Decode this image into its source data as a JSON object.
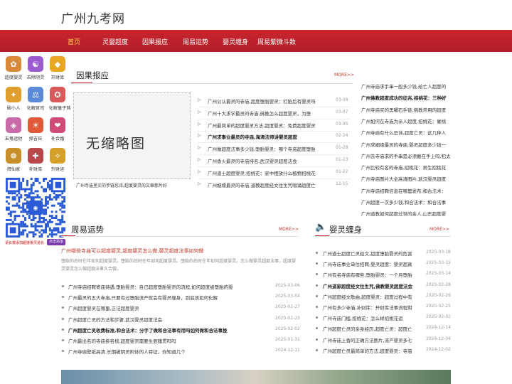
{
  "site": {
    "title": "广州九考网"
  },
  "nav": [
    "首页",
    "灵婴超度",
    "因果报应",
    "周易运势",
    "婴灵缠身",
    "周易紫微斗数"
  ],
  "apps": [
    {
      "label": "超度婴灵",
      "color": "#d9893a",
      "glyph": "✿"
    },
    {
      "label": "去除阴灵",
      "color": "#9a5ad0",
      "glyph": "☯"
    },
    {
      "label": "开财库",
      "color": "#e8a623",
      "glyph": "◆"
    },
    {
      "label": "破小人",
      "color": "#e0a030",
      "glyph": "✦"
    },
    {
      "label": "化解官司",
      "color": "#5a8ad8",
      "glyph": "⚖"
    },
    {
      "label": "化解童子煞",
      "color": "#d85a5a",
      "glyph": "✪"
    },
    {
      "label": "五鬼运财",
      "color": "#c86aa8",
      "glyph": "◈"
    },
    {
      "label": "择吉日",
      "color": "#e05a3a",
      "glyph": "☀"
    },
    {
      "label": "补合婚",
      "color": "#d04a7a",
      "glyph": "❤"
    },
    {
      "label": "拜仙家",
      "color": "#c8902a",
      "glyph": "☸"
    },
    {
      "label": "补财库",
      "color": "#b8484a",
      "glyph": "✚"
    },
    {
      "label": "升财运",
      "color": "#d4a02a",
      "glyph": "✧"
    }
  ],
  "qr": {
    "caption": "请长按添加超度婴灵道长",
    "button": "点击添加"
  },
  "karma": {
    "title": "因果报应",
    "more": "MORE>>",
    "thumb_text": "无缩略图",
    "thumb_caption": "广州寺庙里买的手链忌讳,超度婴灵的文章那片好",
    "items": [
      {
        "text": "广州公认最灵的寺庙,超度堕胎婴灵：打胎后有婴灵吗",
        "date": "03-08",
        "bold": false
      },
      {
        "text": "广州十大求学最灵的寺庙,佛教怎么超度婴灵，为堕",
        "date": "03-07",
        "bold": false
      },
      {
        "text": "广州最简单的超度婴灵方法,超度婴灵：免费超度婴灵",
        "date": "03-05",
        "bold": false
      },
      {
        "text": "广州求事业最灵的寺庙,海清法师讲婴灵超度",
        "date": "02-24",
        "bold": true
      },
      {
        "text": "广州做超度法事多少钱,堕胎婴灵：哪个寺庙超度堕胎",
        "date": "01-28",
        "bold": false
      },
      {
        "text": "广州香火最灵的寺庙排名,武汉婴灵超度法会",
        "date": "01-23",
        "bold": false
      },
      {
        "text": "广州道士超度婴灵,招桃花：家中摆放什么植物招桃花",
        "date": "01-22",
        "bold": false
      },
      {
        "text": "广州姻缘最灵的寺庙,道教超度经文往生咒唱诵超度亡",
        "date": "12-15",
        "bold": false
      }
    ],
    "side": [
      {
        "text": "广州寺庙求手串一般多少钱,给亡人超度的",
        "bold": false
      },
      {
        "text": "广州佛教超度成功的征兆,招桃花：三种好",
        "bold": true
      },
      {
        "text": "广州寺庙买的黑曜石手链,佛教常用的超度",
        "bold": false
      },
      {
        "text": "广州如何在寺庙为亲人超度,招桃花：催桃",
        "bold": false
      },
      {
        "text": "广州寺庙有什么忌讳,超度亡灵：这几种人",
        "bold": false
      },
      {
        "text": "广州求姻缘最灵的寺庙,婴灵超度多少钱一",
        "bold": false
      },
      {
        "text": "广州去寺庙求的手串是必须戴在手上吗,犯太",
        "bold": false
      },
      {
        "text": "广州比较有名的寺庙,招桃花：男生招桃花",
        "bold": false
      },
      {
        "text": "广州寺庙图片大全高清图片,武汉婴灵超度",
        "bold": false
      },
      {
        "text": "广州寺庙招聘信息在哪里发布,和合法术：",
        "bold": false
      },
      {
        "text": "广州超度一次多少钱,和合法术：和合法事",
        "bold": false
      },
      {
        "text": "广州道教如何超度过世的亲人,山东超度婴",
        "bold": false
      }
    ]
  },
  "fortune": {
    "title": "周易运势",
    "more": "MORE>>",
    "headline": "广州哪些寺庙可以超度婴灵,超度婴灵怎么做,婴灵超度法事如何做",
    "summary": "堕胎的后时在年如何超度婴灵。堕胎的后时在年如何超度婴灵。堕胎的后时在年如何超度婴灵。怎么做婴灵超度法事，超度婴灵婴灵怎么做超度法事久合做。",
    "items": [
      {
        "text": "广州寺庙招聘寄庙待遇,堕胎婴灵：自己超度堕胎婴灵的流程,如何超度被堕胎的婴",
        "date": "2025-03-06",
        "bold": false
      },
      {
        "text": "广州最灵的五大寺庙,只要有过堕胎流产就会有婴灵缠身，到底该如何化解",
        "date": "2025-03-04",
        "bold": false
      },
      {
        "text": "广州超度婴灵在哪里,正法超度婴灵",
        "date": "2025-02-27",
        "bold": false
      },
      {
        "text": "广州超度亡灵的方法和步骤,武汉婴灵超度法会",
        "date": "2025-02-23",
        "bold": false
      },
      {
        "text": "广州超度亡灵收费标准,和合法术：分手了做和合法事有用吗如何做和合法事挽",
        "date": "2025-02-02",
        "bold": true
      },
      {
        "text": "广州最出名的寺庙排名榜,超度婴灵需要生辰籍贯吗吗",
        "date": "2025-01-31",
        "bold": false
      },
      {
        "text": "广州寺庙壁纸高清,长期被阴灵附体的人特征，你知道几个",
        "date": "2024-12-11",
        "bold": false
      }
    ]
  },
  "possess": {
    "title": "婴灵缠身",
    "more": "MORE>>",
    "items": [
      {
        "text": "广州道士超度亡灵经文,超度堕胎婴灵的危害",
        "date": "2025-03-18",
        "bold": false
      },
      {
        "text": "广州寺庙事业单位招聘,婴灵超度：婴灵超真",
        "date": "2025-03-15",
        "bold": false
      },
      {
        "text": "广州有名寺庙有哪些,堕胎婴灵：一个月堕胎",
        "date": "2025-03-14",
        "bold": false
      },
      {
        "text": "广州道家超度经文往生咒,佛教婴灵超度法会",
        "date": "2025-02-28",
        "bold": true
      },
      {
        "text": "广州超度经文歌曲,超度婴灵：超度过程中有",
        "date": "2025-02-26",
        "bold": false
      },
      {
        "text": "广州有多少寺庙,补财库：开财库法事流程和",
        "date": "2025-02-25",
        "bold": false
      },
      {
        "text": "广州寺庙门槛,招桃花：怎么样招桃花运",
        "date": "2025-02-01",
        "bold": false
      },
      {
        "text": "广州超度亡灵的亲身经历,超度亡灵：超度亡",
        "date": "2024-12-14",
        "bold": false
      },
      {
        "text": "广州寺庙上香的正确方法图片,流产婴灵多七",
        "date": "2024-12-04",
        "bold": false
      },
      {
        "text": "广州超度亡灵最简单的方法,超度婴灵：寺庙",
        "date": "2024-12-02",
        "bold": false
      }
    ]
  }
}
